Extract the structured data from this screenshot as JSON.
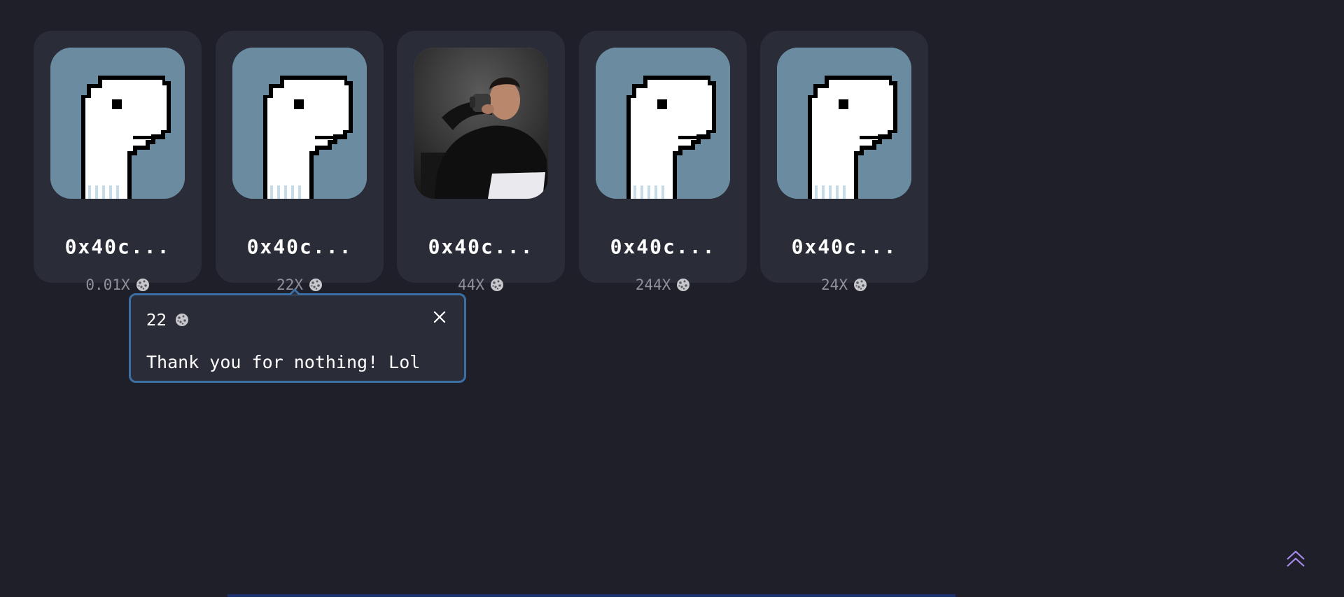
{
  "cards": [
    {
      "address": "0x40c...",
      "multiplier": "0.01X",
      "avatar": "pixel-dino-icon"
    },
    {
      "address": "0x40c...",
      "multiplier": "22X",
      "avatar": "pixel-dino-icon"
    },
    {
      "address": "0x40c...",
      "multiplier": "44X",
      "avatar": "person-drinking-photo"
    },
    {
      "address": "0x40c...",
      "multiplier": "244X",
      "avatar": "pixel-dino-icon"
    },
    {
      "address": "0x40c...",
      "multiplier": "24X",
      "avatar": "pixel-dino-icon"
    }
  ],
  "popup": {
    "amount": "22",
    "message": "Thank you for nothing! Lol",
    "close_icon": "close-icon"
  },
  "icons": {
    "coin": "cookie-coin-icon",
    "scroll_top": "double-chevron-up-icon"
  },
  "colors": {
    "background": "#1e1f28",
    "card": "#2a2c38",
    "avatar_bg": "#6b8ca0",
    "popup_border": "#3c70a4",
    "scroll_top": "#a98cf0"
  }
}
